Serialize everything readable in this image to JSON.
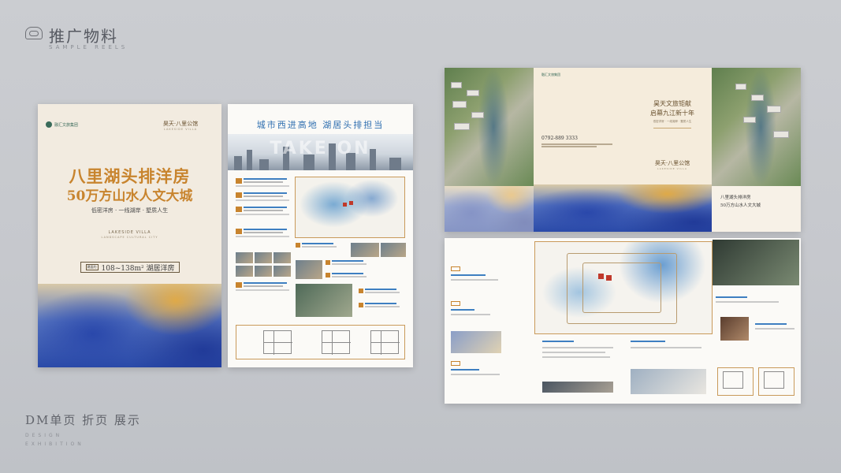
{
  "header": {
    "title": "推广物料",
    "subtitle": "SAMPLE REELS"
  },
  "footer": {
    "title": "DM单页  折页  展示",
    "subtitle_line1": "DESIGN",
    "subtitle_line2": "EXHIBITION"
  },
  "cover": {
    "brand": "融汇文旅集团",
    "seal_title": "昊天·八里公馆",
    "seal_sub": "LAKESIDE VILLA",
    "headline_1": "八里湖头排洋房",
    "headline_2": "50万方山水人文大城",
    "tagline": "低密洋房 · 一线湖岸 · 墅质人生",
    "en_title": "LAKESIDE VILLA",
    "en_sub": "LANDSCAPE CULTURAL CITY",
    "area_tag": "建面约",
    "area_text": "108~138m²  湖居洋房"
  },
  "page2": {
    "headline": "城市西进高地  湖居头排担当",
    "overlay": "TAKE ON"
  },
  "trifold_out": {
    "brand": "融汇文旅集团",
    "phone": "0792-889 3333",
    "title_1": "昊天文旅钜献",
    "title_2": "启幕九江新十年",
    "small": "低密洋房 · 一线湖岸 · 墅质人生",
    "seal_title": "昊天·八里公馆",
    "seal_sub": "LAKESIDE VILLA",
    "right_1": "八里湖头排洋房",
    "right_2": "50万方山水人文大城"
  },
  "colors": {
    "gold": "#c8842e",
    "blue": "#2f6fb0",
    "background": "#c8cacf"
  }
}
